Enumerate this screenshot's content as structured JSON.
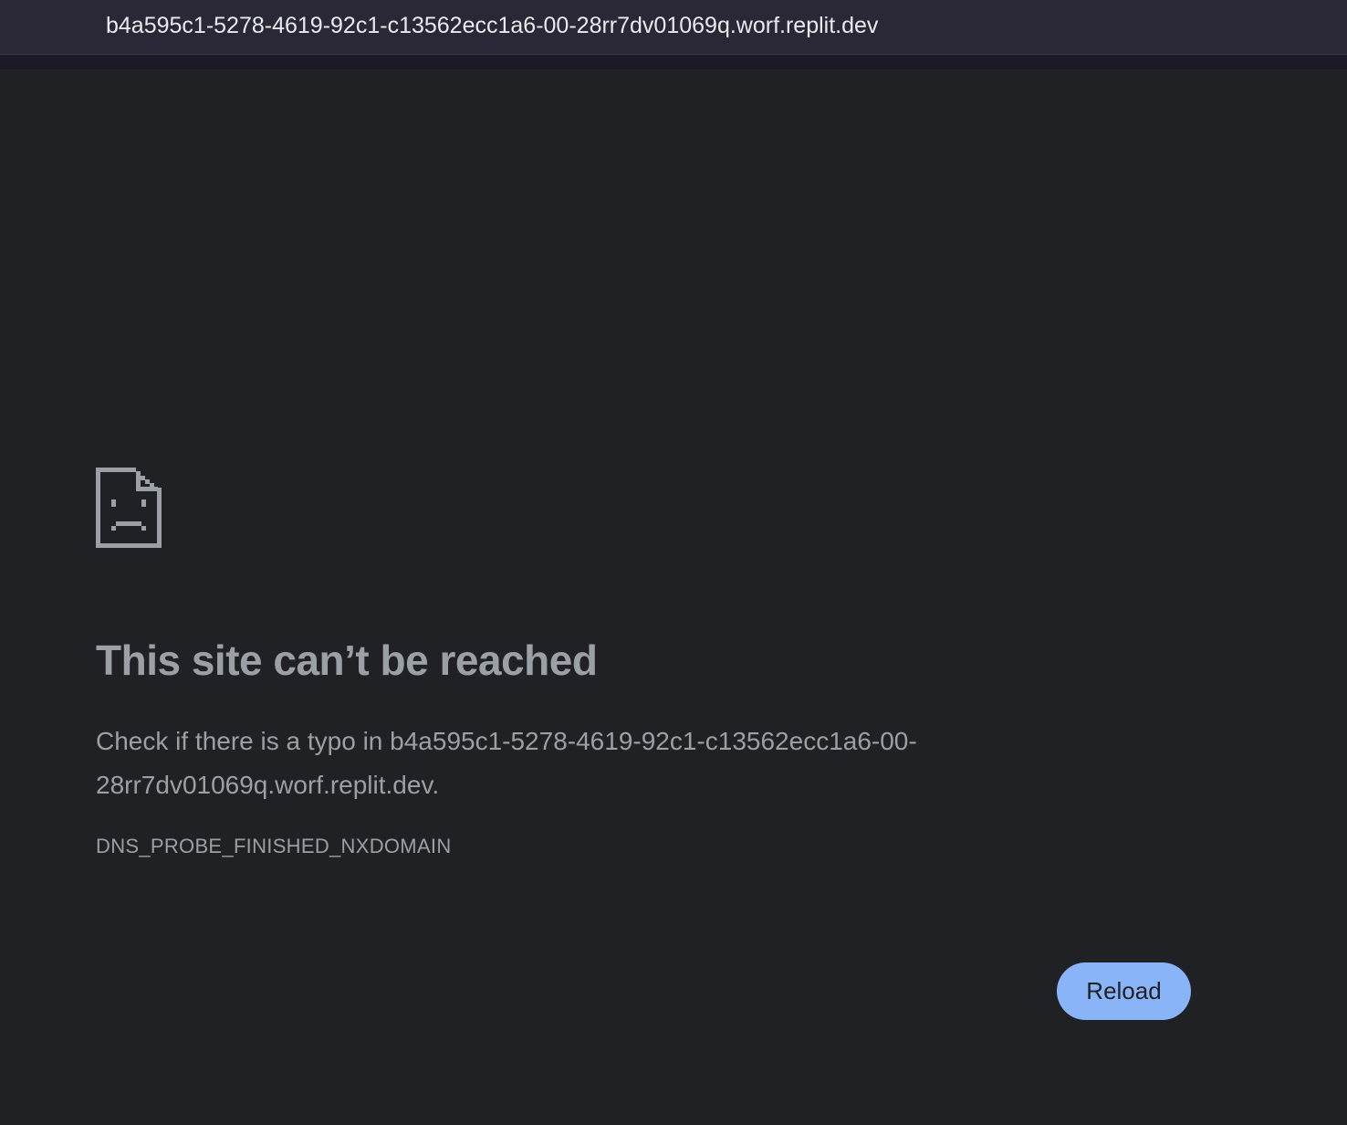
{
  "browser": {
    "url": "b4a595c1-5278-4619-92c1-c13562ecc1a6-00-28rr7dv01069q.worf.replit.dev"
  },
  "error_page": {
    "icon": "sad-page-icon",
    "headline": "This site can’t be reached",
    "message_prefix": "Check if there is a typo in ",
    "message_host": "b4a595c1-5278-4619-92c1-c13562ecc1a6-00-28rr7dv01069q.worf.replit.dev",
    "message_suffix": ".",
    "error_code": "DNS_PROBE_FINISHED_NXDOMAIN",
    "reload_label": "Reload"
  },
  "colors": {
    "background": "#202124",
    "text": "#9aa0a6",
    "button": "#8ab4f8",
    "url_bar": "#2a2836"
  }
}
